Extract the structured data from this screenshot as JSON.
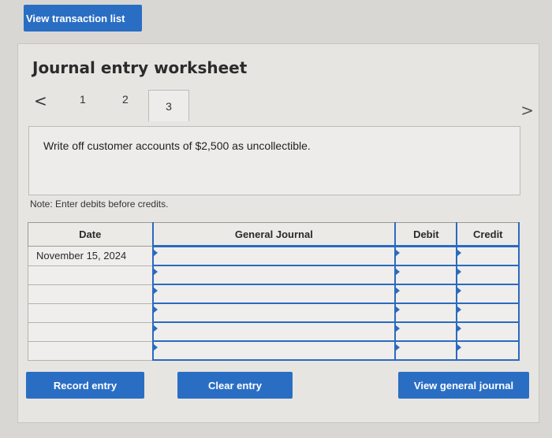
{
  "top": {
    "view_transaction_list": "View transaction list"
  },
  "worksheet": {
    "title": "Journal entry worksheet",
    "tabs": [
      {
        "label": "1"
      },
      {
        "label": "2"
      },
      {
        "label": "3"
      }
    ],
    "prev_arrow": "<",
    "next_arrow": ">",
    "description": "Write off customer accounts of $2,500 as uncollectible.",
    "note": "Note: Enter debits before credits."
  },
  "journal": {
    "headers": {
      "date": "Date",
      "general_journal": "General Journal",
      "debit": "Debit",
      "credit": "Credit"
    },
    "rows": [
      {
        "date": "November 15, 2024"
      },
      {
        "date": ""
      },
      {
        "date": ""
      },
      {
        "date": ""
      },
      {
        "date": ""
      },
      {
        "date": ""
      }
    ]
  },
  "buttons": {
    "record": "Record entry",
    "clear": "Clear entry",
    "view_general_journal": "View general journal"
  },
  "colors": {
    "accent": "#2a6ec4"
  }
}
